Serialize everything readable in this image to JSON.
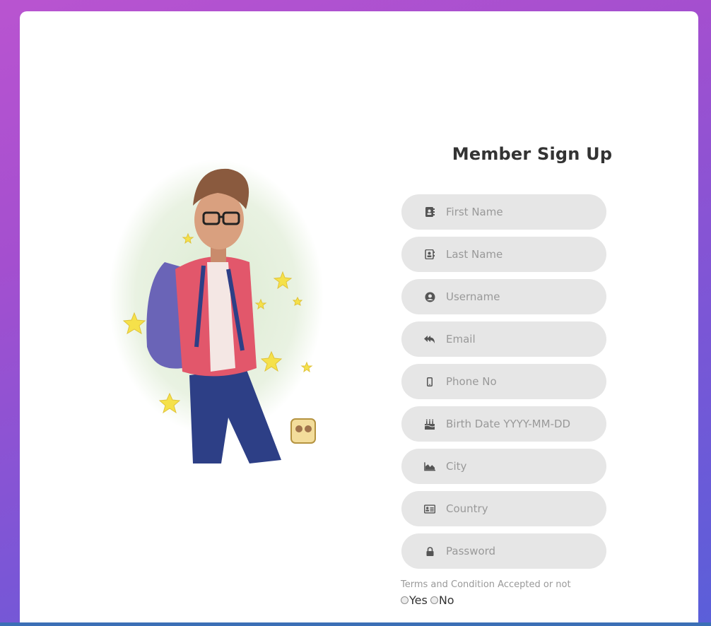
{
  "form": {
    "title": "Member Sign Up",
    "fields": [
      {
        "placeholder": "First Name",
        "icon": "address-book-icon"
      },
      {
        "placeholder": "Last Name",
        "icon": "contact-card-icon"
      },
      {
        "placeholder": "Username",
        "icon": "user-circle-icon"
      },
      {
        "placeholder": "Email",
        "icon": "reply-all-icon"
      },
      {
        "placeholder": "Phone No",
        "icon": "mobile-phone-icon"
      },
      {
        "placeholder": "Birth Date YYYY-MM-DD",
        "icon": "birthday-cake-icon"
      },
      {
        "placeholder": "City",
        "icon": "area-chart-icon"
      },
      {
        "placeholder": "Country",
        "icon": "id-card-icon"
      },
      {
        "placeholder": "Password",
        "icon": "lock-icon"
      }
    ],
    "terms_label": "Terms and Condition Accepted or not",
    "radio_yes": "Yes",
    "radio_no": "No"
  },
  "illustration": {
    "description_icon": "cartoon-avatar-illustration",
    "colors": {
      "jacket": "#e2576b",
      "jeans": "#2d3f86",
      "backpack": "#6a64b7",
      "star": "#f5e14a",
      "wash": "#e6f1df"
    }
  },
  "colors": {
    "field_bg": "#e6e6e6",
    "placeholder": "#999999",
    "title": "#333333",
    "gradient_top": "#b954d0",
    "gradient_bottom": "#5a5fd9"
  }
}
